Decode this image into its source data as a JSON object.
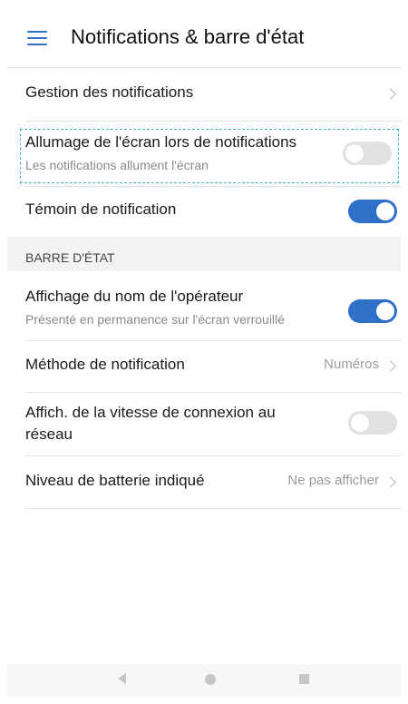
{
  "appbar": {
    "title": "Notifications & barre d'état",
    "menu_icon": "hamburger-menu-icon"
  },
  "rows": {
    "gestion": {
      "title": "Gestion des notifications"
    },
    "allumage": {
      "title": "Allumage de l'écran lors de notifications",
      "subtitle": "Les notifications allument l'écran",
      "toggle_on": false
    },
    "temoin": {
      "title": "Témoin de notification",
      "toggle_on": true
    },
    "operateur": {
      "title": "Affichage du nom de l'opérateur",
      "subtitle": "Présenté en permanence sur l'écran verrouillé",
      "toggle_on": true
    },
    "methode": {
      "title": "Méthode de notification",
      "value": "Numéros"
    },
    "vitesse": {
      "title_line1": "Affich. de la vitesse de connexion au",
      "title_line2": "réseau",
      "toggle_on": false
    },
    "batterie": {
      "title": "Niveau de batterie indiqué",
      "value": "Ne pas afficher"
    }
  },
  "section": {
    "header": "BARRE D'ÉTAT"
  },
  "navbar": {
    "icons": [
      "back-icon",
      "home-icon",
      "recent-apps-icon"
    ]
  },
  "colors": {
    "accent": "#2f70c8",
    "focus_outline": "#3bb6c6",
    "toggle_off": "#e2e2e2"
  }
}
